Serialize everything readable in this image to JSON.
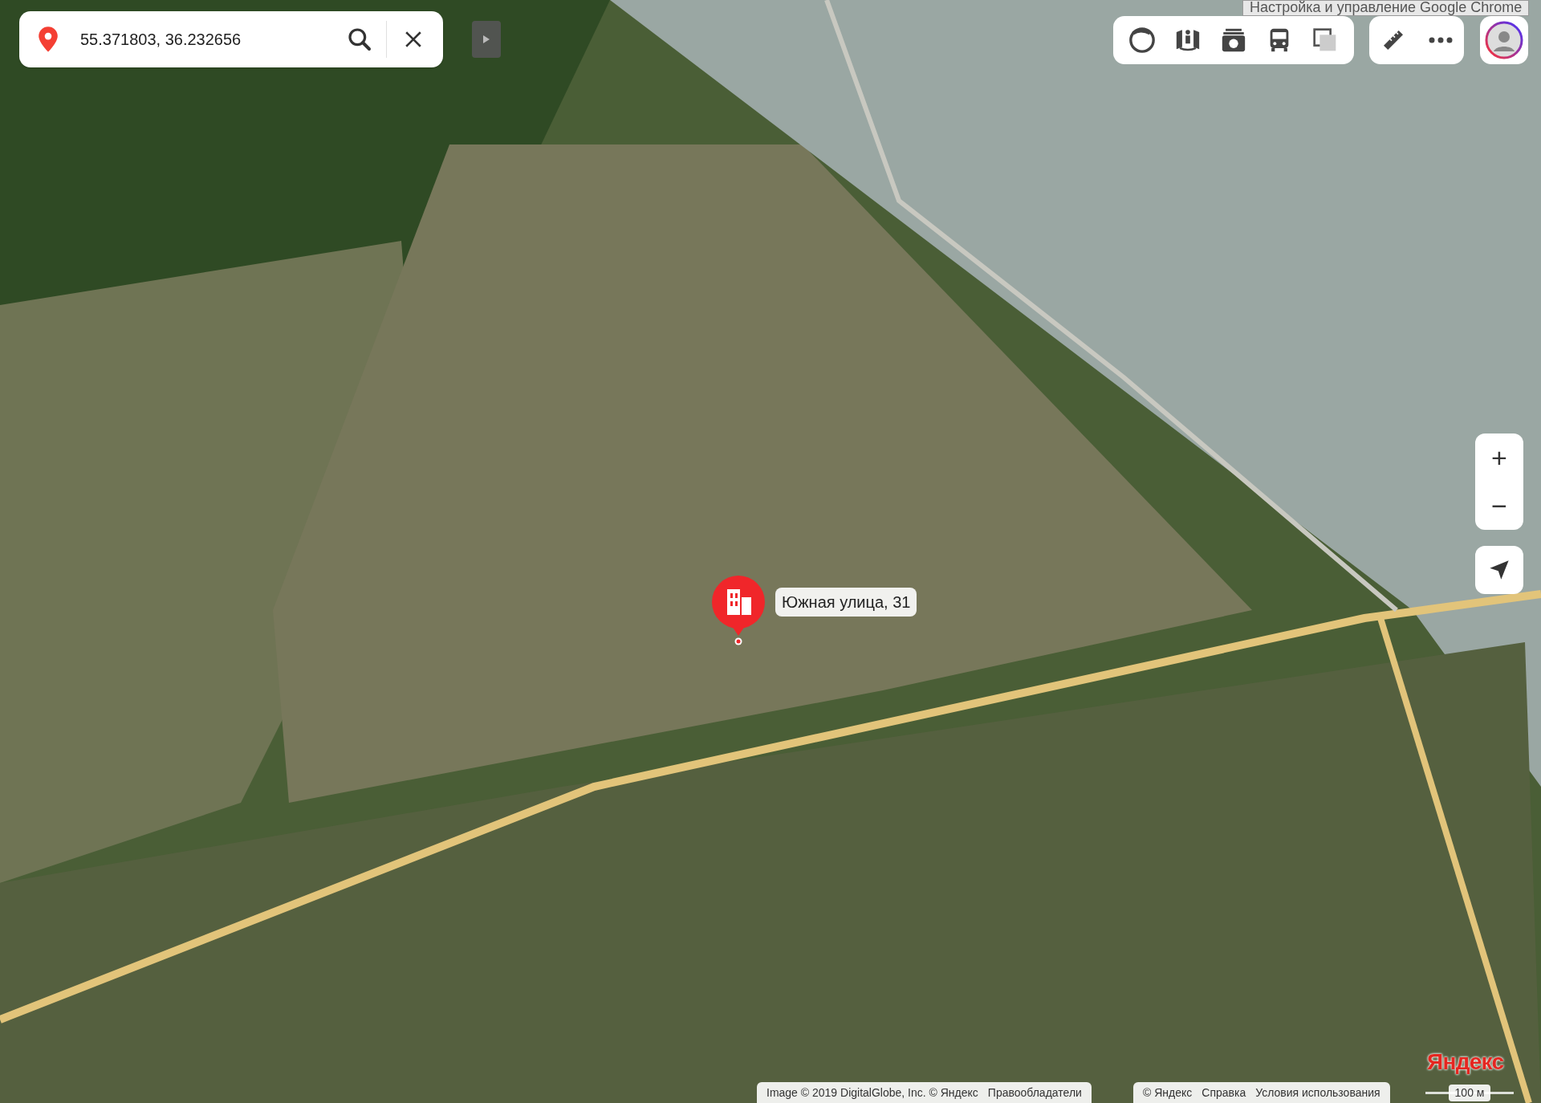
{
  "search": {
    "value": "55.371803, 36.232656"
  },
  "browser_tooltip": "Настройка и управление Google Chrome",
  "marker": {
    "label": "Южная улица, 31"
  },
  "zoom_controls": {
    "plus": "+",
    "minus": "−"
  },
  "footer": {
    "logo": "Яндекс",
    "attribution": [
      "Image © 2019 DigitalGlobe, Inc. © Яндекс",
      "Правообладатели"
    ],
    "links": [
      "© Яндекс",
      "Справка",
      "Условия использования"
    ],
    "scale": "100 м"
  }
}
